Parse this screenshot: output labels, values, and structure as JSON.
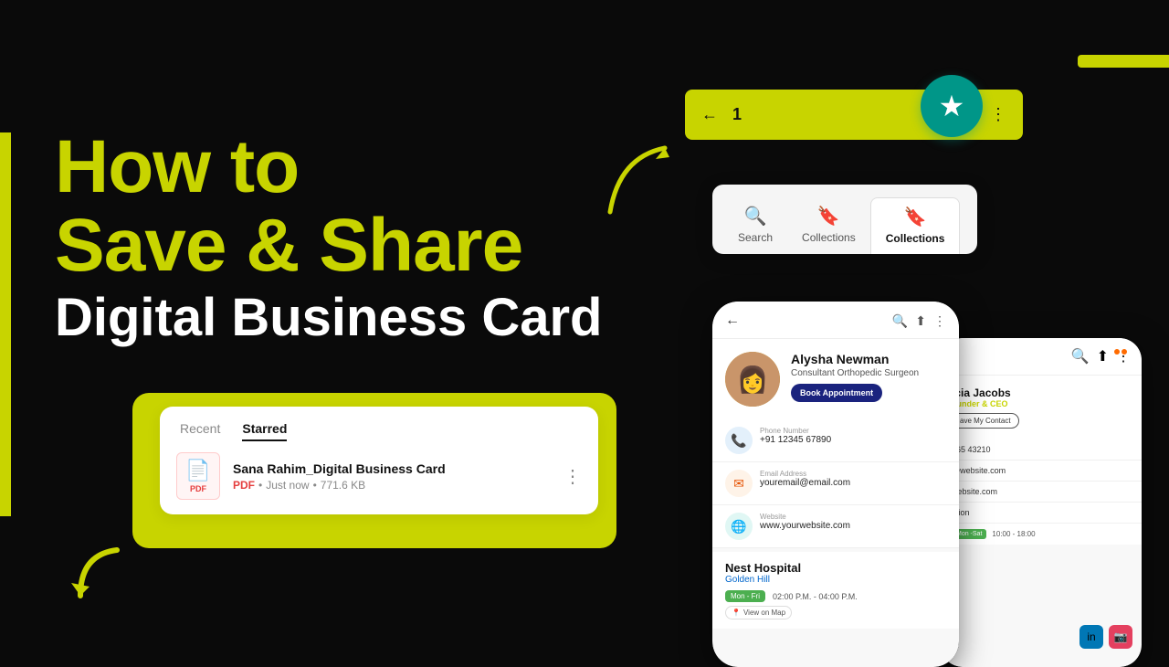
{
  "background": "#0a0a0a",
  "title": {
    "line1": "How to",
    "line2": "Save & Share",
    "line3": "Digital Business Card"
  },
  "file_card": {
    "tabs": [
      {
        "label": "Recent",
        "active": false
      },
      {
        "label": "Starred",
        "active": true
      }
    ],
    "file": {
      "name": "Sana Rahim_Digital Business Card",
      "type": "PDF",
      "time": "Just now",
      "size": "771.6 KB"
    }
  },
  "top_bar": {
    "back": "←",
    "number": "1",
    "reply": "↩",
    "star": "★",
    "more": "⋮"
  },
  "teal_star": "★",
  "collections_popup": {
    "tabs": [
      {
        "label": "Search",
        "icon": "🔍",
        "selected": false
      },
      {
        "label": "Collections",
        "icon": "🔖",
        "selected": false
      },
      {
        "label": "Collections",
        "icon": "🔖",
        "selected": true
      }
    ]
  },
  "phone1": {
    "profile": {
      "name": "Alysha Newman",
      "title": "Consultant Orthopedic Surgeon",
      "book_btn": "Book Appointment"
    },
    "contacts": [
      {
        "label": "Phone Number",
        "value": "+91 12345 67890",
        "icon": "📞",
        "color": "blue"
      },
      {
        "label": "Email Address",
        "value": "youremail@email.com",
        "icon": "✉",
        "color": "orange"
      },
      {
        "label": "Website",
        "value": "www.yourwebsite.com",
        "icon": "🌐",
        "color": "teal"
      }
    ],
    "hospital": {
      "name": "Nest Hospital",
      "location": "Golden Hill",
      "badge": "Mon - Fri",
      "time": "02:00 P.M. - 04:00 P.M.",
      "map_btn": "View on Map"
    }
  },
  "phone2": {
    "name": "icia Jacobs",
    "title": "ounder & CEO",
    "save_btn": "ave My Contact",
    "contacts": [
      {
        "value": "765 43210"
      },
      {
        "value": "@website.com"
      },
      {
        "value": "website.com"
      },
      {
        "value": "ation"
      }
    ],
    "badge": "Mon -Sat",
    "time": "10:00 - 18:00"
  }
}
